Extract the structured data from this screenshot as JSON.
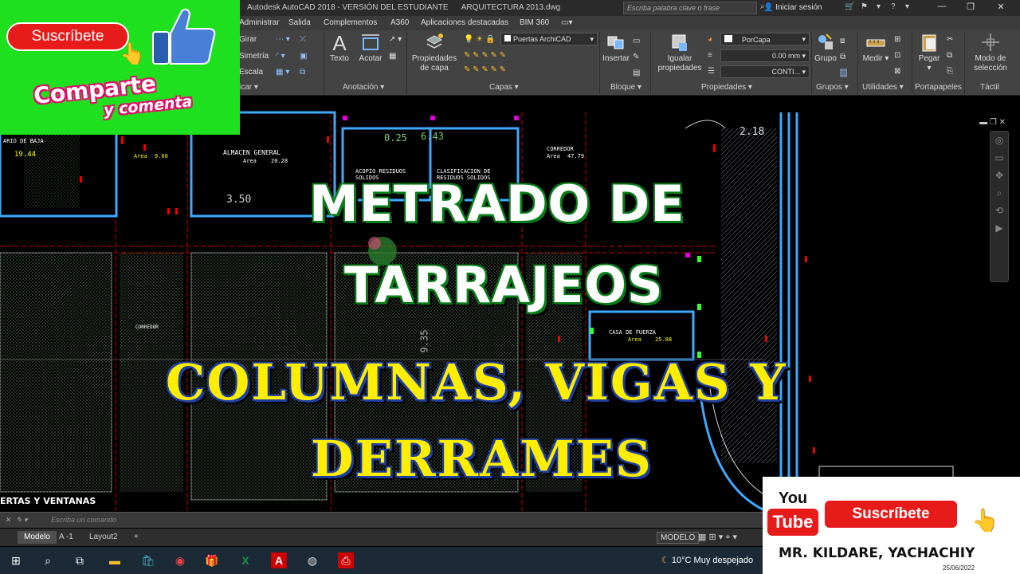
{
  "window": {
    "app_title": "Autodesk AutoCAD 2018 - VERSIÓN DEL ESTUDIANTE",
    "file_name": "ARQUITECTURA 2013.dwg",
    "search_placeholder": "Escriba palabra clave o frase",
    "signin_label": "Iniciar sesión"
  },
  "menu_tabs": [
    "Administrar",
    "Salida",
    "Complementos",
    "A360",
    "Aplicaciones destacadas",
    "BIM 360"
  ],
  "ribbon": {
    "modify_items": [
      "Girar",
      "Simetría",
      "Escala"
    ],
    "modify_label_partial": "icar",
    "text_label": "Texto",
    "dim_label": "Acotar",
    "annotation_label": "Anotación",
    "layer_props_label": "Propiedades de capa",
    "layer_dropdown": "Puertas ArchiCAD",
    "layers_label": "Capas",
    "insert_label": "Insertar",
    "block_label": "Bloque",
    "match_label": "Igualar propiedades",
    "color_dropdown": "PorCapa",
    "lineweight_dropdown": "0.00 mm",
    "linetype_dropdown": "CONTI...",
    "properties_label": "Propiedades",
    "group_label": "Grupo",
    "groups_label": "Grupos",
    "measure_label": "Medir",
    "utilities_label": "Utilidades",
    "paste_label": "Pegar",
    "clipboard_label": "Portapapeles",
    "select_mode_label": "Modo de selección",
    "touch_label": "Táctil"
  },
  "drawing": {
    "labels": {
      "almacen": "ALMACEN GENERAL",
      "area_word": "Area",
      "almacen_area": "20.28",
      "area_9_60": "9.60",
      "corredor_label": "CORREDOR",
      "corredor_area": "47.79",
      "acopio": "ACOPIO RESIDUOS SOLIDOS",
      "clasificacion": "CLASIFICACION DE RESIDUOS SOLIDOS",
      "casa_fuerza": "CASA DE FUERZA",
      "casa_area": "25.08",
      "dim_350": "3.50",
      "dim_218": "2.18",
      "dim_025": "0.25",
      "dim_643": "6.43",
      "dim_935": "9.35",
      "left_area": "19.44",
      "bajo_label": "ARIO DE BAJA",
      "puertas_ventanas": "ERTAS Y VENTANAS",
      "corredor_lower": "CORREDOR"
    }
  },
  "overlay": {
    "line1": "METRADO DE",
    "line2": "TARRAJEOS",
    "line3": "COLUMNAS, VIGAS Y",
    "line4": "DERRAMES"
  },
  "promo": {
    "subscribe": "Suscríbete",
    "share": "Comparte",
    "comment": "y comenta"
  },
  "yt_promo": {
    "logo_you": "You",
    "logo_tube": "Tube",
    "subscribe": "Suscríbete",
    "channel": "MR. KILDARE, YACHACHIY"
  },
  "command": {
    "placeholder": "Escriba un comando"
  },
  "layouts": {
    "tabs": [
      "Modelo",
      "A -1",
      "Layout2",
      "+"
    ],
    "status_model": "MODELO"
  },
  "taskbar": {
    "weather": "10°C  Muy despejado",
    "date": "25/06/2022"
  }
}
